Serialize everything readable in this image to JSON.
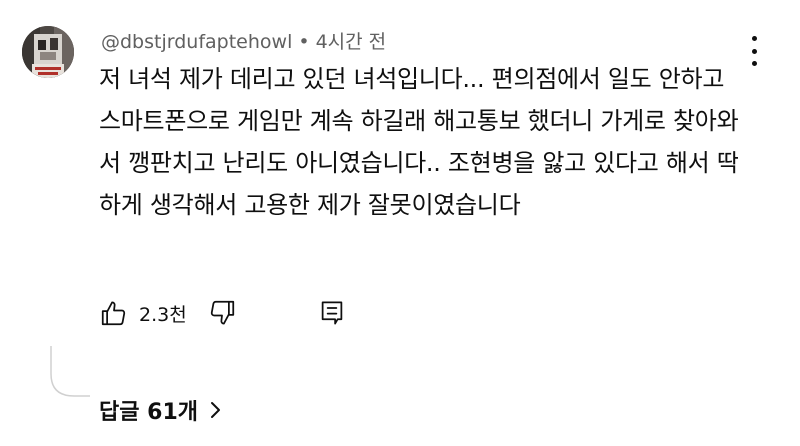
{
  "comment": {
    "author": "@dbstjrdufaptehowl",
    "separator": "•",
    "time": "4시간 전",
    "text": "저 녀석 제가 데리고 있던 녀석입니다... 편의점에서 일도 안하고 스마트폰으로 게임만 계속 하길래 해고통보 했더니 가게로 찾아와서 깽판치고 난리도 아니였습니다.. 조현병을 앓고 있다고 해서 딱하게 생각해서 고용한 제가 잘못이였습니다"
  },
  "actions": {
    "like_count": "2.3천"
  },
  "replies": {
    "label": "답글 61개"
  },
  "icons": {
    "more": "more-vert-icon",
    "like": "thumb-up-icon",
    "dislike": "thumb-down-icon",
    "reply": "reply-icon",
    "chevron": "chevron-right-icon"
  }
}
